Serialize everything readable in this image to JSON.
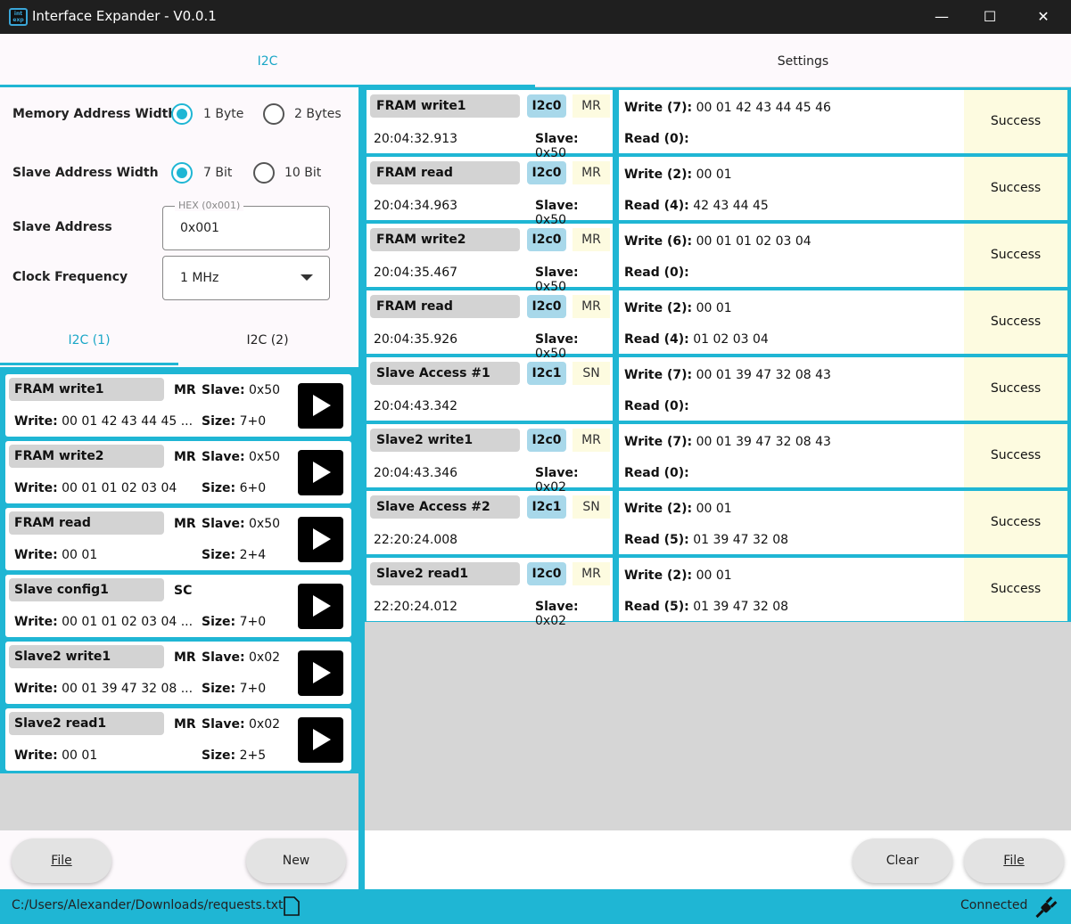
{
  "window": {
    "title": "Interface Expander - V0.0.1",
    "icon_text": "int exp",
    "controls": {
      "minimize": "—",
      "maximize": "☐",
      "close": "✕"
    }
  },
  "tabs": {
    "i2c": "I2C",
    "settings": "Settings"
  },
  "settings": {
    "memory_address_width": {
      "label": "Memory Address Width",
      "options": [
        "1 Byte",
        "2 Bytes"
      ],
      "selected": "1 Byte"
    },
    "slave_address_width": {
      "label": "Slave Address Width",
      "options": [
        "7 Bit",
        "10 Bit"
      ],
      "selected": "7 Bit"
    },
    "slave_address": {
      "label": "Slave Address",
      "hint": "HEX (0x001)",
      "value": "0x001"
    },
    "clock_frequency": {
      "label": "Clock Frequency",
      "value": "1 MHz"
    }
  },
  "subtabs": {
    "i2c1": "I2C (1)",
    "i2c2": "I2C (2)"
  },
  "requests": [
    {
      "name": "FRAM write1",
      "mode": "MR",
      "slave_label": "Slave:",
      "slave": "0x50",
      "write_label": "Write:",
      "write": "00 01 42 43 44 45 ...",
      "size_label": "Size:",
      "size": "7+0"
    },
    {
      "name": "FRAM write2",
      "mode": "MR",
      "slave_label": "Slave:",
      "slave": "0x50",
      "write_label": "Write:",
      "write": "00 01 01 02 03 04",
      "size_label": "Size:",
      "size": "6+0"
    },
    {
      "name": "FRAM read",
      "mode": "MR",
      "slave_label": "Slave:",
      "slave": "0x50",
      "write_label": "Write:",
      "write": "00 01",
      "size_label": "Size:",
      "size": "2+4"
    },
    {
      "name": "Slave config1",
      "mode": "SC",
      "slave_label": "",
      "slave": "",
      "write_label": "Write:",
      "write": "00 01 01 02 03 04 ...",
      "size_label": "Size:",
      "size": "7+0"
    },
    {
      "name": "Slave2 write1",
      "mode": "MR",
      "slave_label": "Slave:",
      "slave": "0x02",
      "write_label": "Write:",
      "write": "00 01 39 47 32 08 ...",
      "size_label": "Size:",
      "size": "7+0"
    },
    {
      "name": "Slave2 read1",
      "mode": "MR",
      "slave_label": "Slave:",
      "slave": "0x02",
      "write_label": "Write:",
      "write": "00 01",
      "size_label": "Size:",
      "size": "2+5"
    }
  ],
  "left_buttons": {
    "file": "File",
    "new": "New"
  },
  "log": [
    {
      "name": "FRAM write1",
      "bus": "I2c0",
      "mode": "MR",
      "time": "20:04:32.913",
      "slave_label": "Slave:",
      "slave": "0x50",
      "write_label": "Write (7):",
      "write": "00 01 42 43 44 45 46",
      "read_label": "Read (0):",
      "read": "",
      "status": "Success"
    },
    {
      "name": "FRAM read",
      "bus": "I2c0",
      "mode": "MR",
      "time": "20:04:34.963",
      "slave_label": "Slave:",
      "slave": "0x50",
      "write_label": "Write (2):",
      "write": "00 01",
      "read_label": "Read (4):",
      "read": "42 43 44 45",
      "status": "Success"
    },
    {
      "name": "FRAM write2",
      "bus": "I2c0",
      "mode": "MR",
      "time": "20:04:35.467",
      "slave_label": "Slave:",
      "slave": "0x50",
      "write_label": "Write (6):",
      "write": "00 01 01 02 03 04",
      "read_label": "Read (0):",
      "read": "",
      "status": "Success"
    },
    {
      "name": "FRAM read",
      "bus": "I2c0",
      "mode": "MR",
      "time": "20:04:35.926",
      "slave_label": "Slave:",
      "slave": "0x50",
      "write_label": "Write (2):",
      "write": "00 01",
      "read_label": "Read (4):",
      "read": "01 02 03 04",
      "status": "Success"
    },
    {
      "name": "Slave Access #1",
      "bus": "I2c1",
      "mode": "SN",
      "time": "20:04:43.342",
      "slave_label": "",
      "slave": "",
      "write_label": "Write (7):",
      "write": "00 01 39 47 32 08 43",
      "read_label": "Read (0):",
      "read": "",
      "status": "Success"
    },
    {
      "name": "Slave2 write1",
      "bus": "I2c0",
      "mode": "MR",
      "time": "20:04:43.346",
      "slave_label": "Slave:",
      "slave": "0x02",
      "write_label": "Write (7):",
      "write": "00 01 39 47 32 08 43",
      "read_label": "Read (0):",
      "read": "",
      "status": "Success"
    },
    {
      "name": "Slave Access #2",
      "bus": "I2c1",
      "mode": "SN",
      "time": "22:20:24.008",
      "slave_label": "",
      "slave": "",
      "write_label": "Write (2):",
      "write": "00 01",
      "read_label": "Read (5):",
      "read": "01 39 47 32 08",
      "status": "Success"
    },
    {
      "name": "Slave2 read1",
      "bus": "I2c0",
      "mode": "MR",
      "time": "22:20:24.012",
      "slave_label": "Slave:",
      "slave": "0x02",
      "write_label": "Write (2):",
      "write": "00 01",
      "read_label": "Read (5):",
      "read": "01 39 47 32 08",
      "status": "Success"
    }
  ],
  "right_buttons": {
    "clear": "Clear",
    "file": "File"
  },
  "statusbar": {
    "path": "C:/Users/Alexander/Downloads/requests.txt",
    "connection": "Connected",
    "file_icon": "file-icon",
    "plug_icon": "plug-icon"
  },
  "colors": {
    "accent": "#1fb6d4",
    "status_bg": "#fdfbe0",
    "bus_badge": "#a8d8ea"
  }
}
